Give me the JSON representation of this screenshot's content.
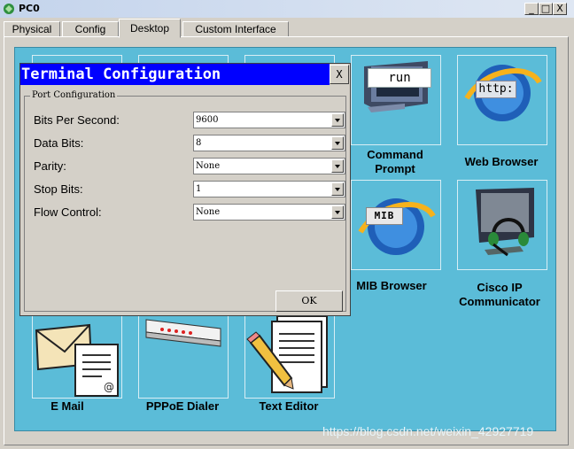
{
  "window": {
    "title": "PC0",
    "minimize": "_",
    "maximize": "□",
    "close": "X"
  },
  "tabs": [
    {
      "label": "Physical"
    },
    {
      "label": "Config"
    },
    {
      "label": "Desktop",
      "active": true
    },
    {
      "label": "Custom Interface"
    }
  ],
  "apps": {
    "command_prompt": {
      "label_line1": "Command",
      "label_line2": "Prompt",
      "icon_text": "run"
    },
    "web_browser": {
      "label": "Web Browser",
      "icon_text": "http:"
    },
    "mib_browser": {
      "label": "MIB Browser",
      "icon_text": "MIB"
    },
    "cisco_ip_communicator": {
      "label_line1": "Cisco IP",
      "label_line2": "Communicator"
    },
    "email": {
      "label": "E Mail"
    },
    "pppoe_dialer": {
      "label": "PPPoE Dialer"
    },
    "text_editor": {
      "label": "Text Editor"
    }
  },
  "dialog": {
    "title": "Terminal Configuration",
    "close_label": "X",
    "group_title": "Port Configuration",
    "fields": {
      "bits_per_second": {
        "label": "Bits Per Second:",
        "value": "9600"
      },
      "data_bits": {
        "label": "Data Bits:",
        "value": "8"
      },
      "parity": {
        "label": "Parity:",
        "value": "None"
      },
      "stop_bits": {
        "label": "Stop Bits:",
        "value": "1"
      },
      "flow_control": {
        "label": "Flow Control:",
        "value": "None"
      }
    },
    "ok_label": "OK"
  },
  "watermark": "https://blog.csdn.net/weixin_42927719",
  "colors": {
    "desktop_bg": "#5bbcd8",
    "dialog_title_bg": "#0000ff",
    "window_chrome": "#d4d0c8"
  }
}
